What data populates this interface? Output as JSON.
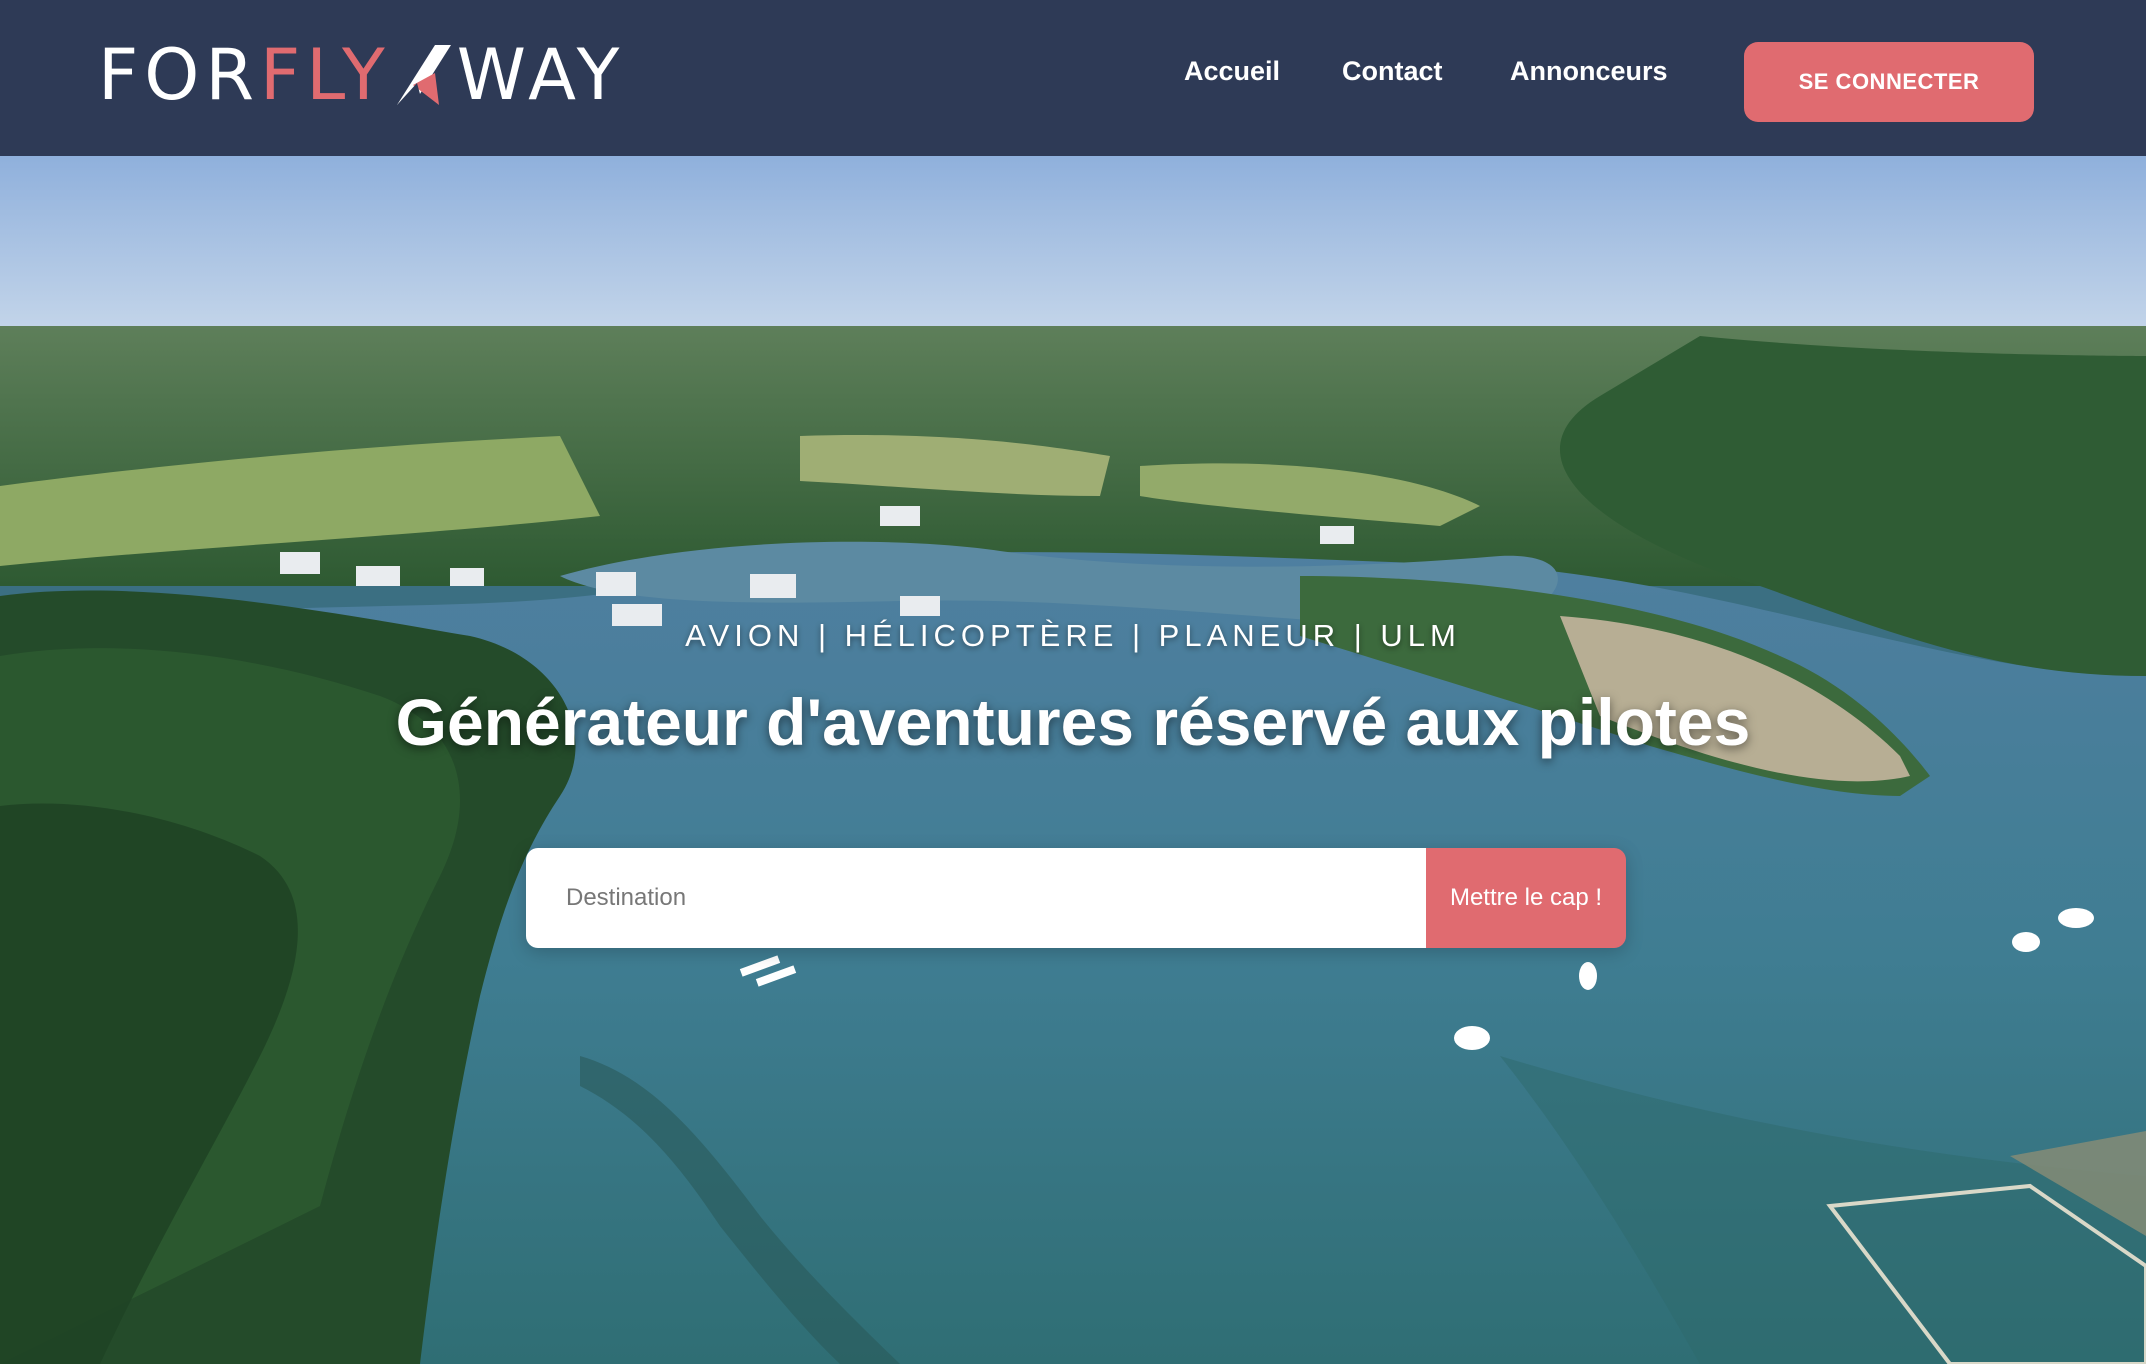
{
  "brand": {
    "part1": "FOR",
    "part2": "FLY",
    "part3": "WAY",
    "accent_color": "#e06b70",
    "header_color": "#2e3a56"
  },
  "nav": {
    "items": [
      {
        "label": "Accueil"
      },
      {
        "label": "Contact"
      },
      {
        "label": "Annonceurs"
      }
    ],
    "login_label": "SE CONNECTER"
  },
  "hero": {
    "subtitle": "AVION | HÉLICOPTÈRE | PLANEUR | ULM",
    "title": "Générateur d'aventures réservé aux pilotes",
    "search": {
      "placeholder": "Destination",
      "value": "",
      "button_label": "Mettre le cap !"
    }
  }
}
